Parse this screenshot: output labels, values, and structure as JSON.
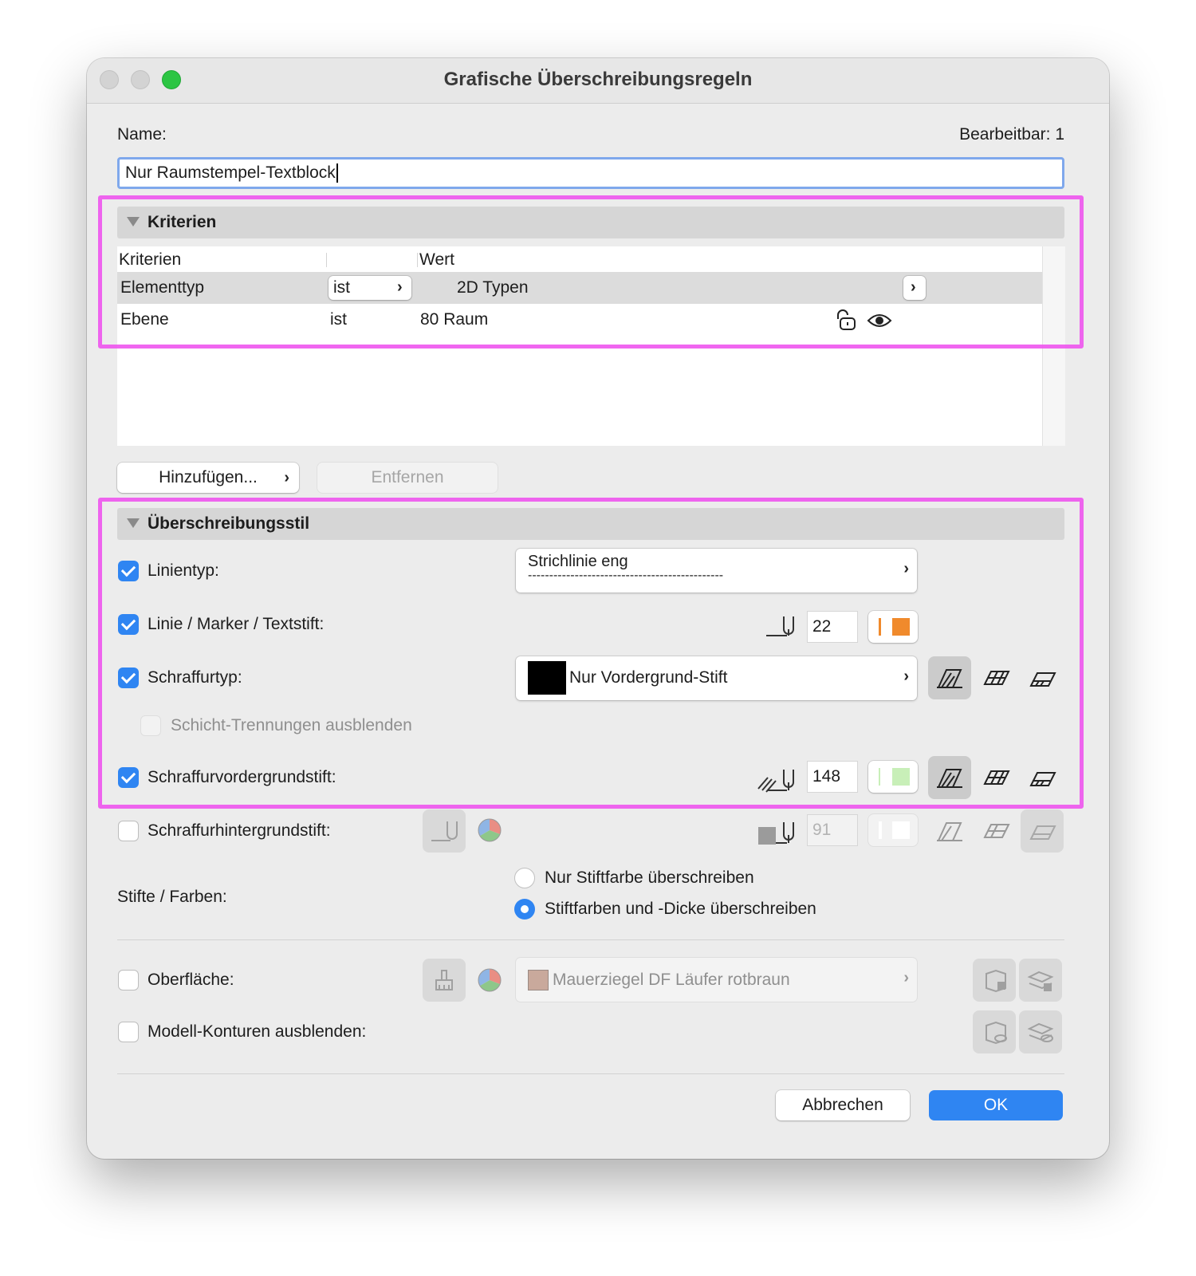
{
  "window": {
    "title": "Grafische Überschreibungsregeln"
  },
  "name": {
    "label": "Name:",
    "editable_label": "Bearbeitbar: 1",
    "value": "Nur Raumstempel-Textblock"
  },
  "criteria": {
    "section_title": "Kriterien",
    "columns": [
      "Kriterien",
      "Wert"
    ],
    "rows": [
      {
        "criterion": "Elementtyp",
        "operator": "ist",
        "value": "2D Typen"
      },
      {
        "criterion": "Ebene",
        "operator": "ist",
        "value": "80 Raum"
      }
    ],
    "add_button": "Hinzufügen...",
    "remove_button": "Entfernen"
  },
  "style": {
    "section_title": "Überschreibungsstil",
    "linetype": {
      "label": "Linientyp:",
      "checked": true,
      "value": "Strichlinie eng",
      "pattern": "----------------------------------------------"
    },
    "line_pen": {
      "label": "Linie / Marker / Textstift:",
      "checked": true,
      "pen": "22",
      "color": "#f08a2c"
    },
    "fill_type": {
      "label": "Schraffurtyp:",
      "checked": true,
      "value": "Nur Vordergrund-Stift",
      "swatch": "#000000"
    },
    "hide_layers": {
      "label": "Schicht-Trennungen ausblenden",
      "checked": false
    },
    "fill_fg_pen": {
      "label": "Schraffurvordergrundstift:",
      "checked": true,
      "pen": "148",
      "color": "#c8efb8"
    },
    "fill_bg_pen": {
      "label": "Schraffurhintergrundstift:",
      "checked": false,
      "pen": "91"
    },
    "pens_colors": {
      "label": "Stifte / Farben:",
      "options": [
        "Nur Stiftfarbe überschreiben",
        "Stiftfarben und -Dicke überschreiben"
      ],
      "selected": 1
    },
    "surface": {
      "label": "Oberfläche:",
      "checked": false,
      "value": "Mauerziegel DF Läufer rotbraun",
      "swatch": "#c9a99c"
    },
    "model_contours": {
      "label": "Modell-Konturen ausblenden:",
      "checked": false
    }
  },
  "footer": {
    "cancel": "Abbrechen",
    "ok": "OK"
  },
  "colors": {
    "accent": "#2f85f2",
    "highlight": "#ee55ee"
  }
}
